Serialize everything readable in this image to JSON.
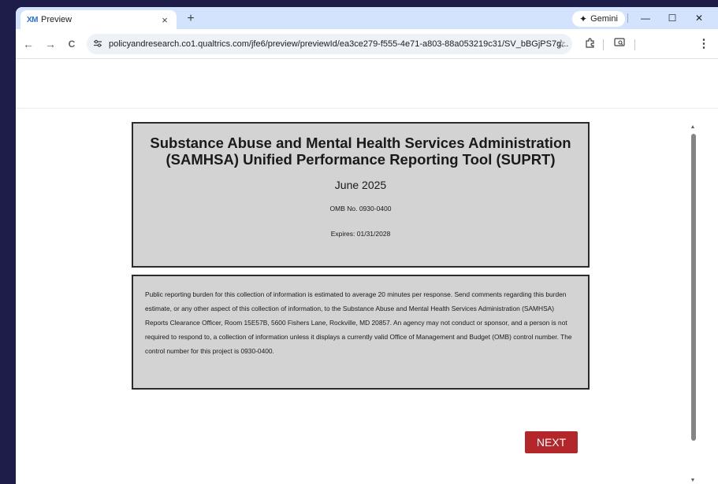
{
  "browser": {
    "tab": {
      "favicon_text": "XM",
      "title": "Preview",
      "close_glyph": "×"
    },
    "new_tab_glyph": "+",
    "gemini_label": "Gemini",
    "window_controls": {
      "minimize": "—",
      "maximize": "☐",
      "close": "✕"
    },
    "nav": {
      "back": "←",
      "forward": "→",
      "reload": "C"
    },
    "url": "policyandresearch.co1.qualtrics.com/jfe6/preview/previewId/ea3ce279-f555-4e71-a803-88a053219c31/SV_bBGjPS7g...",
    "menu_glyph": "⋮"
  },
  "survey": {
    "title": "Substance Abuse and Mental Health Services Administration (SAMHSA) Unified Performance Reporting Tool (SUPRT)",
    "date": "June 2025",
    "omb_no": "OMB No. 0930-0400",
    "expires": "Expires: 01/31/2028",
    "burden_statement": "Public reporting burden for this collection of information is estimated to average 20 minutes per response. Send comments regarding this burden estimate, or any other aspect of this collection of information, to the Substance Abuse and Mental Health Services Administration (SAMHSA) Reports Clearance Officer, Room 15E57B, 5600 Fishers Lane, Rockville, MD 20857. An agency may not conduct or sponsor, and a person is not required to respond to, a collection of information unless it displays a currently valid Office of Management and Budget (OMB) control number. The control number for this project is 0930-0400.",
    "next_label": "NEXT"
  },
  "colors": {
    "next_button": "#b3262a",
    "box_fill": "#d3d3d3",
    "tabbar": "#d3e3fd"
  },
  "icons": {
    "site_info": "tune-icon",
    "bookmark": "star-icon",
    "extensions": "puzzle-icon",
    "screen_search": "screen-search-icon"
  }
}
